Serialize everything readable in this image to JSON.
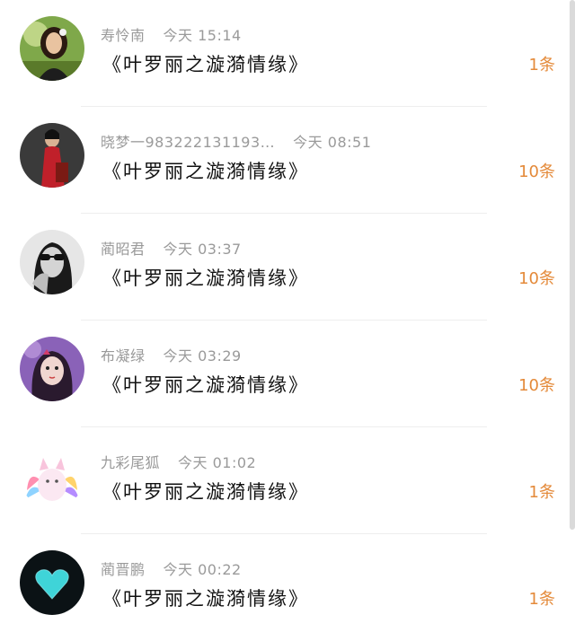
{
  "items": [
    {
      "name": "寿怜南",
      "time": "今天 15:14",
      "title": "《叶罗丽之漩漪情缘》",
      "count": "1条",
      "avatar": "girl-avatar"
    },
    {
      "name": "晓梦一983222131193…",
      "time": "今天 08:51",
      "title": "《叶罗丽之漩漪情缘》",
      "count": "10条",
      "avatar": "red-dress-avatar"
    },
    {
      "name": "蔺昭君",
      "time": "今天 03:37",
      "title": "《叶罗丽之漩漪情缘》",
      "count": "10条",
      "avatar": "sunglasses-avatar"
    },
    {
      "name": "布凝绿",
      "time": "今天 03:29",
      "title": "《叶罗丽之漩漪情缘》",
      "count": "10条",
      "avatar": "purple-girl-avatar"
    },
    {
      "name": "九彩尾狐",
      "time": "今天 01:02",
      "title": "《叶罗丽之漩漪情缘》",
      "count": "1条",
      "avatar": "rainbow-fox-avatar"
    },
    {
      "name": "蔺晋鹏",
      "time": "今天 00:22",
      "title": "《叶罗丽之漩漪情缘》",
      "count": "1条",
      "avatar": "blue-heart-avatar"
    }
  ],
  "colors": {
    "accent": "#e48a3a",
    "meta": "#9a9a9a",
    "text": "#111111"
  }
}
